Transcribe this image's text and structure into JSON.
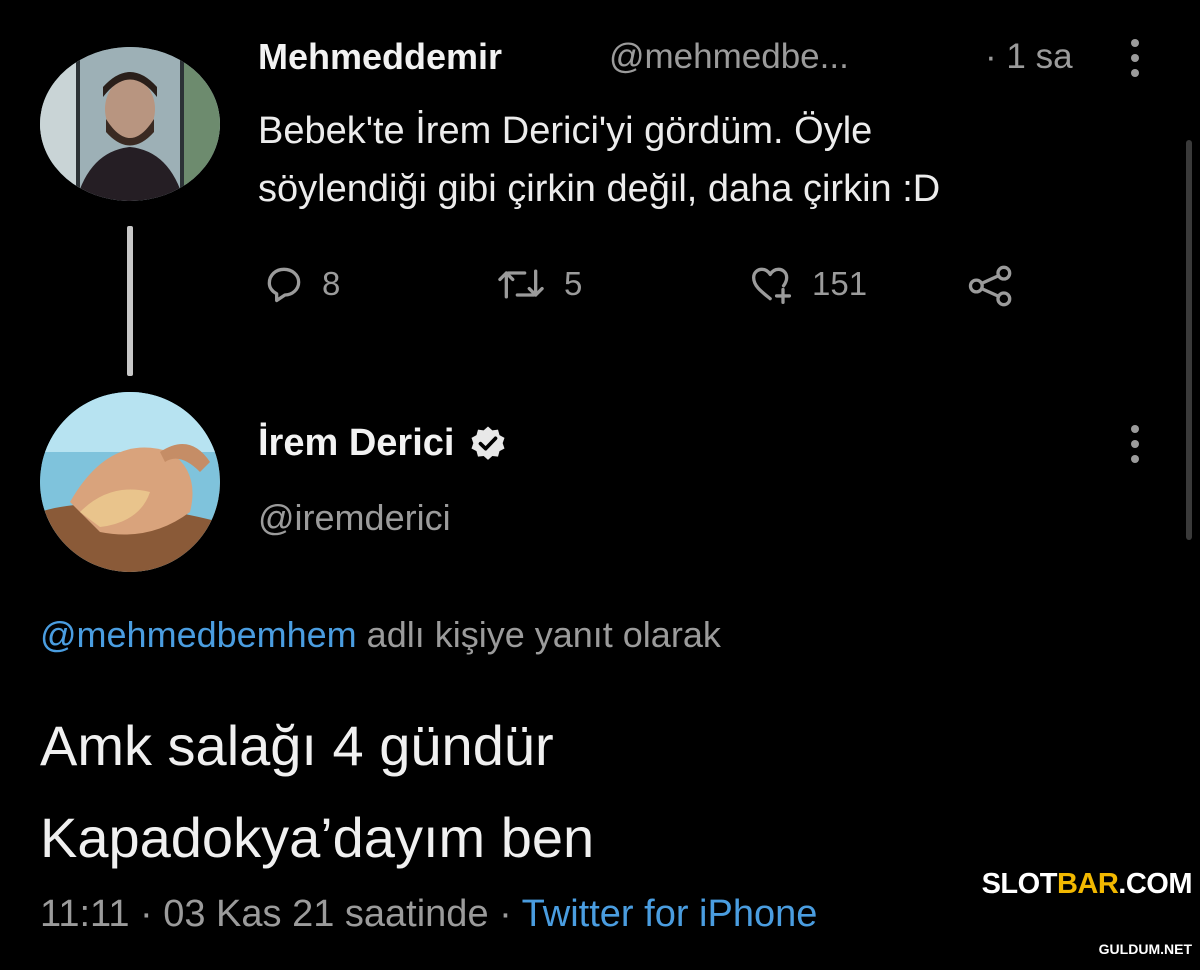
{
  "tweet1": {
    "display_name": "Mehmeddemir",
    "handle": "@mehmedbe...",
    "time": "· 1 sa",
    "text_line1": "Bebek'te İrem Derici'yi gördüm. Öyle",
    "text_line2": "söylendiği gibi çirkin değil, daha çirkin :D",
    "replies": "8",
    "retweets": "5",
    "likes": "151"
  },
  "tweet2": {
    "display_name": "İrem Derici",
    "handle": "@iremderici",
    "reply_to_mention": "@mehmedbemhem",
    "reply_to_suffix": " adlı kişiye yanıt olarak",
    "text_line1": "Amk salağı 4 gündür",
    "text_line2": "Kapadokya’dayım ben",
    "timestamp": "11:11 · 03 Kas 21 saatinde · ",
    "source": "Twitter for iPhone"
  },
  "watermark": {
    "slot_prefix": "SLOT",
    "slot_bar": "BAR",
    "slot_suffix": ".COM",
    "guldum": "GULDUM.NET"
  },
  "icons": {
    "reply": "reply-icon",
    "retweet": "retweet-icon",
    "like": "like-icon",
    "share": "share-icon",
    "more": "more-vertical-icon",
    "verified": "verified-icon"
  },
  "colors": {
    "background": "#000000",
    "link": "#4a9de0",
    "muted": "#9b9b9b",
    "watermark_accent": "#f2b800"
  }
}
